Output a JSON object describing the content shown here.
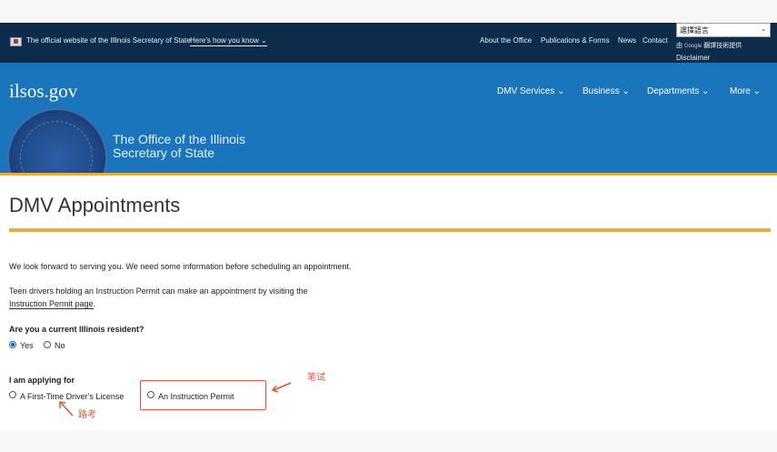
{
  "topbar": {
    "official_text": "The official website of the Illinois Secretary of State",
    "howknow_text": "Here's how you know",
    "links": [
      "About the Office",
      "Publications & Forms",
      "News",
      "Contact"
    ],
    "language_select": "選擇語言",
    "powered_by": "由",
    "powered_google": "Google",
    "powered_suffix": "翻譯技術提供",
    "disclaimer": "Disclaimer"
  },
  "header": {
    "logo": "ilsos.gov",
    "nav": [
      "DMV Services",
      "Business",
      "Departments",
      "More"
    ],
    "office_line1": "The Office of the Illinois",
    "office_line2": "Secretary of State"
  },
  "main": {
    "title": "DMV Appointments",
    "intro": "We look forward to serving you. We need some information before scheduling an appointment.",
    "teen_text": "Teen drivers holding an Instruction Permit can make an appointment by visiting the",
    "teen_link": "Instruction Permit page",
    "teen_period": ".",
    "question_resident": "Are you a current Illinois resident?",
    "resident_options": [
      "Yes",
      "No"
    ],
    "resident_selected": "Yes",
    "question_applying": "I am applying for",
    "applying_options": [
      "A First-Time Driver's License",
      "An Instruction Permit"
    ]
  },
  "annotations": {
    "written_test": "笔试",
    "road_test": "路考",
    "color": "#e0533a"
  },
  "colors": {
    "topbar": "#0d2b4a",
    "brand_blue": "#1a75bc",
    "gold": "#e2b33c"
  }
}
